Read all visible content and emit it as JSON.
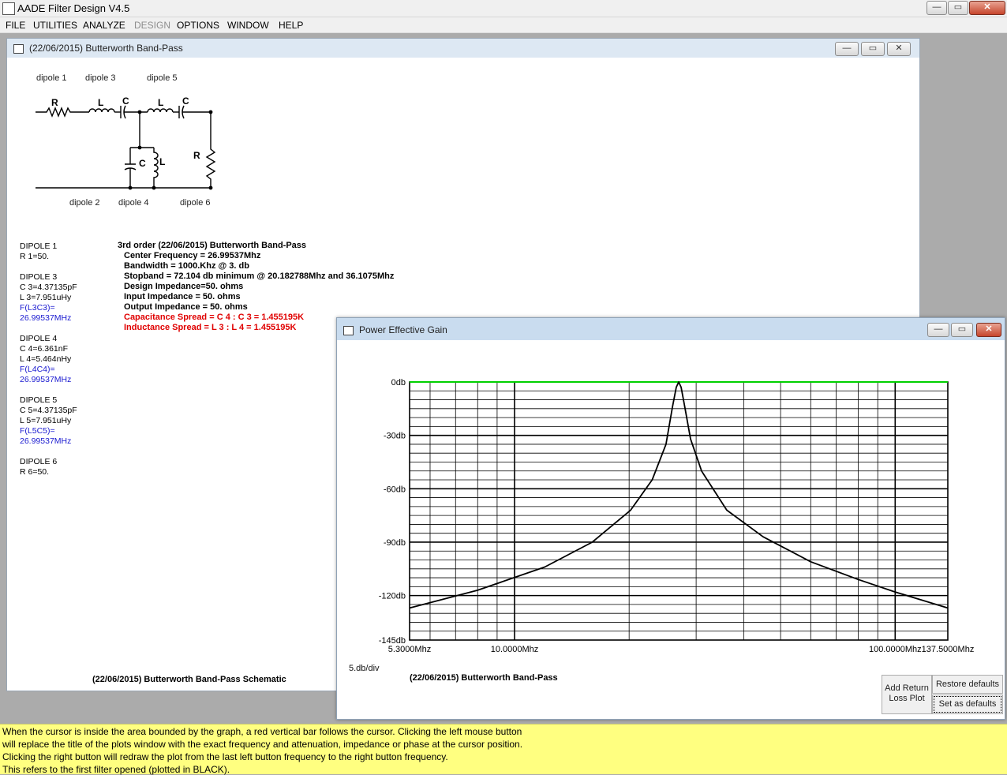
{
  "app": {
    "title": "AADE Filter Design V4.5",
    "buttons": {
      "minimize": "—",
      "maximize": "▭",
      "close": "✕"
    }
  },
  "menu": [
    {
      "label": "FILE",
      "disabled": false
    },
    {
      "label": "UTILITIES",
      "disabled": false
    },
    {
      "label": "ANALYZE",
      "disabled": false
    },
    {
      "label": "DESIGN",
      "disabled": true
    },
    {
      "label": "OPTIONS",
      "disabled": false
    },
    {
      "label": "WINDOW",
      "disabled": false
    },
    {
      "label": "HELP",
      "disabled": false
    }
  ],
  "schematic_window": {
    "title": "(22/06/2015) Butterworth Band-Pass",
    "dipole_labels_top": [
      "dipole  1",
      "dipole  3",
      "dipole  5"
    ],
    "dipole_labels_bottom": [
      "dipole  2",
      "dipole  4",
      "dipole  6"
    ],
    "component_letters": {
      "R1": "R",
      "L3": "L",
      "C3": "C",
      "L5": "L",
      "C5": "C",
      "C4": "C",
      "L4": "L",
      "R6": "R"
    },
    "components": [
      {
        "text": "DIPOLE 1",
        "color": "black"
      },
      {
        "text": "R 1=50.",
        "color": "black"
      },
      {
        "text": "",
        "color": "black"
      },
      {
        "text": "DIPOLE 3",
        "color": "black"
      },
      {
        "text": "C 3=4.37135pF",
        "color": "black"
      },
      {
        "text": "L 3=7.951uHy",
        "color": "black"
      },
      {
        "text": "F(L3C3)=",
        "color": "blue"
      },
      {
        "text": " 26.99537MHz",
        "color": "blue"
      },
      {
        "text": "",
        "color": "black"
      },
      {
        "text": "DIPOLE 4",
        "color": "black"
      },
      {
        "text": "C 4=6.361nF",
        "color": "black"
      },
      {
        "text": "L 4=5.464nHy",
        "color": "black"
      },
      {
        "text": "F(L4C4)=",
        "color": "blue"
      },
      {
        "text": " 26.99537MHz",
        "color": "blue"
      },
      {
        "text": "",
        "color": "black"
      },
      {
        "text": "DIPOLE 5",
        "color": "black"
      },
      {
        "text": "C 5=4.37135pF",
        "color": "black"
      },
      {
        "text": "L 5=7.951uHy",
        "color": "black"
      },
      {
        "text": "F(L5C5)=",
        "color": "blue"
      },
      {
        "text": " 26.99537MHz",
        "color": "blue"
      },
      {
        "text": "",
        "color": "black"
      },
      {
        "text": "DIPOLE 6",
        "color": "black"
      },
      {
        "text": "R 6=50.",
        "color": "black"
      }
    ],
    "specs": [
      {
        "text": "3rd order (22/06/2015) Butterworth Band-Pass",
        "color": "black",
        "indent": false
      },
      {
        "text": "Center Frequency = 26.99537Mhz",
        "color": "black",
        "indent": true
      },
      {
        "text": "Bandwidth = 1000.Khz @ 3. db",
        "color": "black",
        "indent": true
      },
      {
        "text": "Stopband = 72.104 db minimum @ 20.182788Mhz and 36.1075Mhz",
        "color": "black",
        "indent": true
      },
      {
        "text": "Design Impedance=50. ohms",
        "color": "black",
        "indent": true
      },
      {
        "text": "Input Impedance = 50. ohms",
        "color": "black",
        "indent": true
      },
      {
        "text": "Output Impedance = 50. ohms",
        "color": "black",
        "indent": true
      },
      {
        "text": "Capacitance Spread = C 4 : C 3 = 1.455195K",
        "color": "red",
        "indent": true
      },
      {
        "text": "Inductance Spread = L 3 : L 4 = 1.455195K",
        "color": "red",
        "indent": true
      }
    ],
    "footer": "(22/06/2015) Butterworth Band-Pass Schematic"
  },
  "gain_window": {
    "title": "Power Effective Gain",
    "scale_label": "5.db/div",
    "plot_title": "(22/06/2015) Butterworth Band-Pass",
    "buttons": {
      "add_return": [
        "Add Return",
        "Loss Plot"
      ],
      "restore": "Restore defaults",
      "set_defaults": "Set as defaults"
    }
  },
  "chart_data": {
    "type": "line",
    "title": "Power Effective Gain",
    "xscale": "log",
    "xlim": [
      5.3,
      137.5
    ],
    "ylim": [
      -145,
      0
    ],
    "x_tick_labels": [
      "5.3000Mhz",
      "10.0000Mhz",
      "100.0000Mhz",
      "137.5000Mhz"
    ],
    "x_ticks": [
      5.3,
      10,
      100,
      137.5
    ],
    "y_tick_labels": [
      "0db",
      "-30db",
      "-60db",
      "-90db",
      "-120db",
      "-145db"
    ],
    "y_ticks": [
      0,
      -30,
      -60,
      -90,
      -120,
      -145
    ],
    "grid": true,
    "series": [
      {
        "color": "#000000",
        "x": [
          5.3,
          8,
          12,
          16,
          20.18,
          23,
          25,
          26,
          26.6,
          27,
          27.4,
          28,
          29,
          31,
          36.11,
          45,
          60,
          80,
          100,
          137.5
        ],
        "y": [
          -127,
          -117,
          -104,
          -90,
          -72,
          -55,
          -35,
          -14,
          -3,
          0,
          -3,
          -14,
          -32,
          -50,
          -72,
          -87,
          -101,
          -111,
          -118,
          -127
        ]
      }
    ]
  },
  "status": {
    "lines": [
      "When the cursor is inside the area bounded by the graph, a red vertical bar follows the cursor. Clicking the left mouse button",
      "will replace the title of the plots window with the exact frequency and attenuation, impedance or phase at the cursor position.",
      "Clicking the right button will redraw the plot from the last left button frequency to the right button frequency.",
      "This refers to the first filter opened (plotted in BLACK)."
    ]
  }
}
